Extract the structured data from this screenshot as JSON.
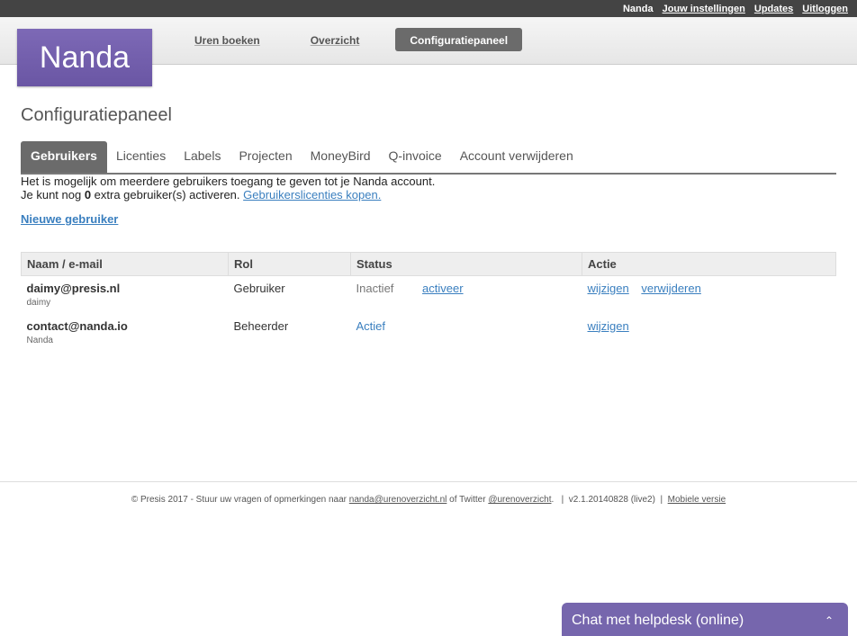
{
  "topbar": {
    "user": "Nanda",
    "links": [
      "Jouw instellingen",
      "Updates",
      "Uitloggen"
    ]
  },
  "logo": "Nanda",
  "nav": {
    "items": [
      "Uren boeken",
      "Overzicht",
      "Configuratiepaneel"
    ],
    "active": "Configuratiepaneel"
  },
  "page_title": "Configuratiepaneel",
  "tabs": [
    "Gebruikers",
    "Licenties",
    "Labels",
    "Projecten",
    "MoneyBird",
    "Q-invoice",
    "Account verwijderen"
  ],
  "info": {
    "line1": "Het is mogelijk om meerdere gebruikers toegang te geven tot je Nanda account.",
    "line2_pre": "Je kunt nog ",
    "line2_count": "0",
    "line2_post": " extra gebruiker(s) activeren. ",
    "line2_link": "Gebruikerslicenties kopen.",
    "new_user": "Nieuwe gebruiker"
  },
  "table": {
    "headers": [
      "Naam / e-mail",
      "Rol",
      "Status",
      "Actie"
    ],
    "rows": [
      {
        "email": "daimy@presis.nl",
        "name": "daimy",
        "role": "Gebruiker",
        "status": "Inactief",
        "status_action": "activeer",
        "actions": [
          "wijzigen",
          "verwijderen"
        ]
      },
      {
        "email": "contact@nanda.io",
        "name": "Nanda",
        "role": "Beheerder",
        "status": "Actief",
        "actions": [
          "wijzigen"
        ]
      }
    ]
  },
  "footer": {
    "text1": "© Presis 2017 - Stuur uw vragen of opmerkingen naar ",
    "email": "nanda@urenoverzicht.nl",
    "text2": " of Twitter ",
    "twitter": "@urenoverzicht",
    "text3": ".   |  v2.1.20140828 (live2)  |  ",
    "mobile": "Mobiele versie"
  },
  "chat": {
    "label": "Chat met helpdesk (online)",
    "icon": "chevron-up-icon"
  }
}
